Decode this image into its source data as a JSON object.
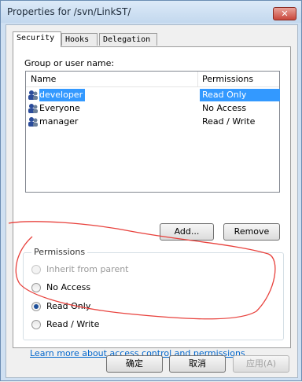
{
  "window": {
    "title": "Properties for /svn/LinkST/",
    "close_glyph": "✕"
  },
  "tabs": [
    {
      "label": "Security",
      "active": true
    },
    {
      "label": "Hooks",
      "active": false
    },
    {
      "label": "Delegation",
      "active": false
    }
  ],
  "security": {
    "group_label": "Group or user name:",
    "columns": {
      "name": "Name",
      "permissions": "Permissions"
    },
    "users": [
      {
        "name": "developer",
        "permission": "Read Only",
        "selected": true,
        "icon": "group-icon"
      },
      {
        "name": "Everyone",
        "permission": "No Access",
        "selected": false,
        "icon": "group-icon"
      },
      {
        "name": "manager",
        "permission": "Read / Write",
        "selected": false,
        "icon": "group-icon"
      }
    ],
    "add_label": "Add...",
    "remove_label": "Remove",
    "permissions_group": {
      "title": "Permissions",
      "options": [
        {
          "label": "Inherit from parent",
          "checked": false,
          "disabled": true
        },
        {
          "label": "No Access",
          "checked": false,
          "disabled": false
        },
        {
          "label": "Read Only",
          "checked": true,
          "disabled": false
        },
        {
          "label": "Read / Write",
          "checked": false,
          "disabled": false
        }
      ]
    },
    "help_link": "Learn more about access control and permissions"
  },
  "footer": {
    "ok_label": "确定",
    "cancel_label": "取消",
    "apply_label": "应用(A)"
  },
  "colors": {
    "selection": "#3399ff",
    "link": "#0066cc",
    "annotation": "#e8413c"
  }
}
